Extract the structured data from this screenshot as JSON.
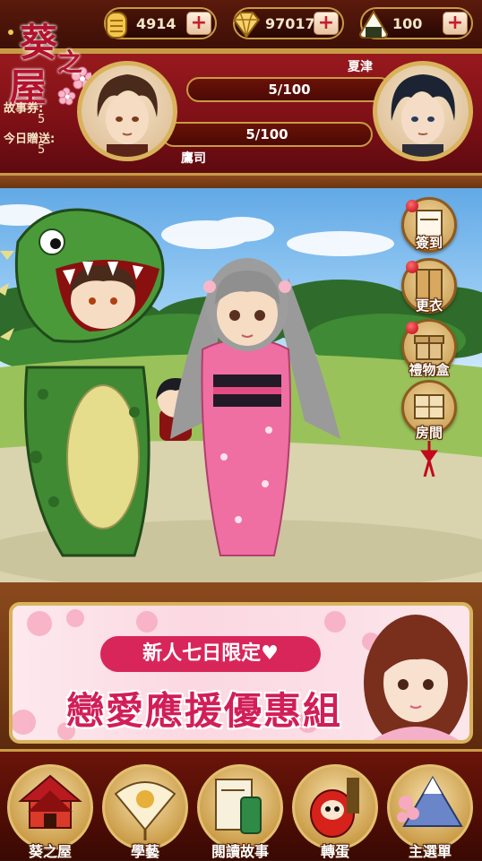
{
  "currency": {
    "coins": "4914",
    "gems": "97017",
    "riceballs": "100",
    "add_label": "+"
  },
  "logo": {
    "char1": "葵",
    "char2": "之",
    "char3": "屋"
  },
  "side_info": {
    "story_tickets_label": "故事券:",
    "story_tickets_value": "5",
    "daily_gift_label": "今日贈送:",
    "daily_gift_value": "5"
  },
  "characters": {
    "left": {
      "name": "鷹司",
      "affection": "5/100"
    },
    "right": {
      "name": "夏津",
      "affection": "5/100"
    }
  },
  "side_menu": [
    {
      "label": "簽到",
      "icon": "calendar-icon"
    },
    {
      "label": "更衣",
      "icon": "wardrobe-icon"
    },
    {
      "label": "禮物盒",
      "icon": "gift-box-icon"
    },
    {
      "label": "房間",
      "icon": "room-icon"
    }
  ],
  "promo": {
    "pill_text": "新人七日限定♥",
    "title": "戀愛應援優惠組"
  },
  "nav": [
    {
      "label": "葵之屋",
      "icon": "house-icon"
    },
    {
      "label": "學藝",
      "icon": "fan-icon"
    },
    {
      "label": "閱讀故事",
      "icon": "book-icon"
    },
    {
      "label": "轉蛋",
      "icon": "daruma-icon"
    },
    {
      "label": "主選單",
      "icon": "mountain-icon"
    }
  ],
  "colors": {
    "header_red": "#8a141a",
    "gold": "#c99a45",
    "promo_pink": "#d21e58",
    "plus_red": "#c81e2d"
  }
}
